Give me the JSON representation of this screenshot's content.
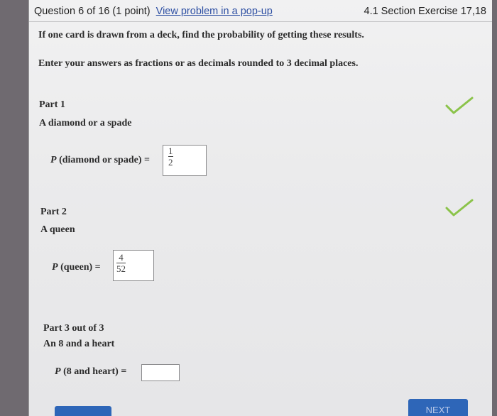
{
  "header": {
    "question_info": "Question 6 of 16 (1 point)",
    "popup_link": "View problem in a pop-up",
    "section": "4.1 Section Exercise 17,18"
  },
  "instructions": {
    "line1": "If one card is drawn from a deck, find the probability of getting these results.",
    "line2": "Enter your answers as fractions or as decimals rounded to 3 decimal places."
  },
  "parts": [
    {
      "title": "Part 1",
      "text": "A diamond or a spade",
      "prob_func": "P",
      "prob_arg": "(diamond or spade) =",
      "answer_num": "1",
      "answer_den": "2",
      "status": "correct"
    },
    {
      "title": "Part 2",
      "text": "A queen",
      "prob_func": "P",
      "prob_arg": "(queen) =",
      "answer_num": "4",
      "answer_den": "52",
      "status": "correct"
    },
    {
      "title": "Part 3 out of 3",
      "text": "An 8 and a heart",
      "prob_func": "P",
      "prob_arg": "(8 and heart) =",
      "answer_value": ""
    }
  ],
  "footer": {
    "next_label": "NEXT"
  },
  "colors": {
    "check": "#8bc34a",
    "link": "#2d4fa3",
    "button": "#2e66b8"
  }
}
